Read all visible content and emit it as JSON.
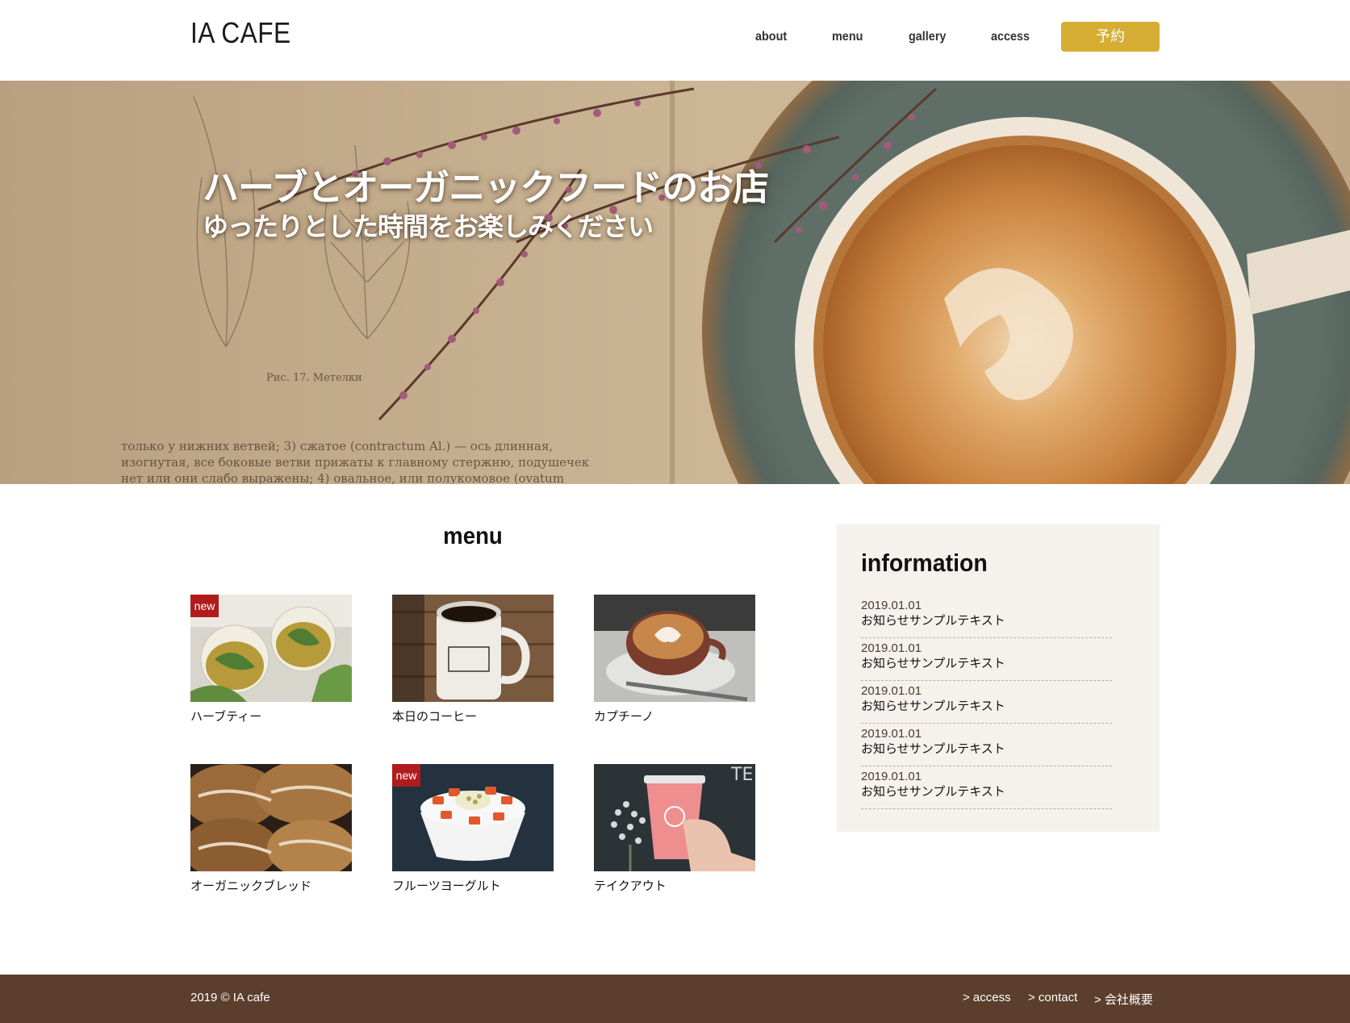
{
  "header": {
    "logo": "IA CAFE",
    "nav": [
      "about",
      "menu",
      "gallery",
      "access"
    ],
    "reserve_button": "予約"
  },
  "hero": {
    "title": "ハーブとオーガニックフードのお店",
    "subtitle": "ゆったりとした時間をお楽しみください",
    "page_text_1": "Рис. 17. Метелки",
    "page_text_2": "только у нижних ветвей; 3) сжатое (contractum Al.) — ось длинная,",
    "page_text_3": "изогнутая, все боковые ветви прижаты к главному стержню, подушечек",
    "page_text_4": "нет или они слабо выражены; 4) овальное, или полукомовое (ovatum"
  },
  "menu": {
    "title": "menu",
    "new_badge": "new",
    "items": [
      {
        "label": "ハーブティー",
        "is_new": true
      },
      {
        "label": "本日のコーヒー",
        "is_new": false
      },
      {
        "label": "カプチーノ",
        "is_new": false
      },
      {
        "label": "オーガニックブレッド",
        "is_new": false
      },
      {
        "label": "フルーツヨーグルト",
        "is_new": true
      },
      {
        "label": "テイクアウト",
        "is_new": false
      }
    ]
  },
  "information": {
    "title": "information",
    "items": [
      {
        "date": "2019.01.01",
        "text": "お知らせサンプルテキスト"
      },
      {
        "date": "2019.01.01",
        "text": "お知らせサンプルテキスト"
      },
      {
        "date": "2019.01.01",
        "text": "お知らせサンプルテキスト"
      },
      {
        "date": "2019.01.01",
        "text": "お知らせサンプルテキスト"
      },
      {
        "date": "2019.01.01",
        "text": "お知らせサンプルテキスト"
      }
    ]
  },
  "footer": {
    "copyright": "2019 © IA cafe",
    "links": [
      "> access",
      "> contact",
      "> 会社概要"
    ]
  },
  "colors": {
    "accent_gold": "#d4ad32",
    "footer_brown": "#5b3e2b",
    "new_badge_red": "#b01c1c",
    "info_bg": "#f5f1ed"
  }
}
